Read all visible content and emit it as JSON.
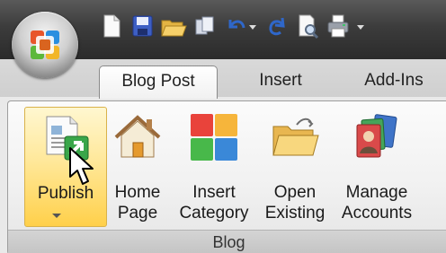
{
  "tabs": [
    {
      "label": "Blog Post",
      "active": true
    },
    {
      "label": "Insert",
      "active": false
    },
    {
      "label": "Add-Ins",
      "active": false
    }
  ],
  "quick_access": [
    "new-icon",
    "save-icon",
    "open-folder-icon",
    "copy-icon",
    "undo-icon",
    "redo-icon",
    "print-preview-icon",
    "print-icon"
  ],
  "group": {
    "label": "Blog",
    "buttons": [
      {
        "label_line1": "Publish",
        "label_line2": "",
        "icon": "publish-icon",
        "hovered": true,
        "has_dropdown": true
      },
      {
        "label_line1": "Home",
        "label_line2": "Page",
        "icon": "home-icon"
      },
      {
        "label_line1": "Insert",
        "label_line2": "Category",
        "icon": "insert-category-icon"
      },
      {
        "label_line1": "Open",
        "label_line2": "Existing",
        "icon": "open-existing-icon"
      },
      {
        "label_line1": "Manage",
        "label_line2": "Accounts",
        "icon": "manage-accounts-icon"
      }
    ]
  },
  "colors": {
    "hover_fill": "#ffd04a",
    "titlebar": "#3c3c3c",
    "tab_row": "#d9d9d9"
  }
}
